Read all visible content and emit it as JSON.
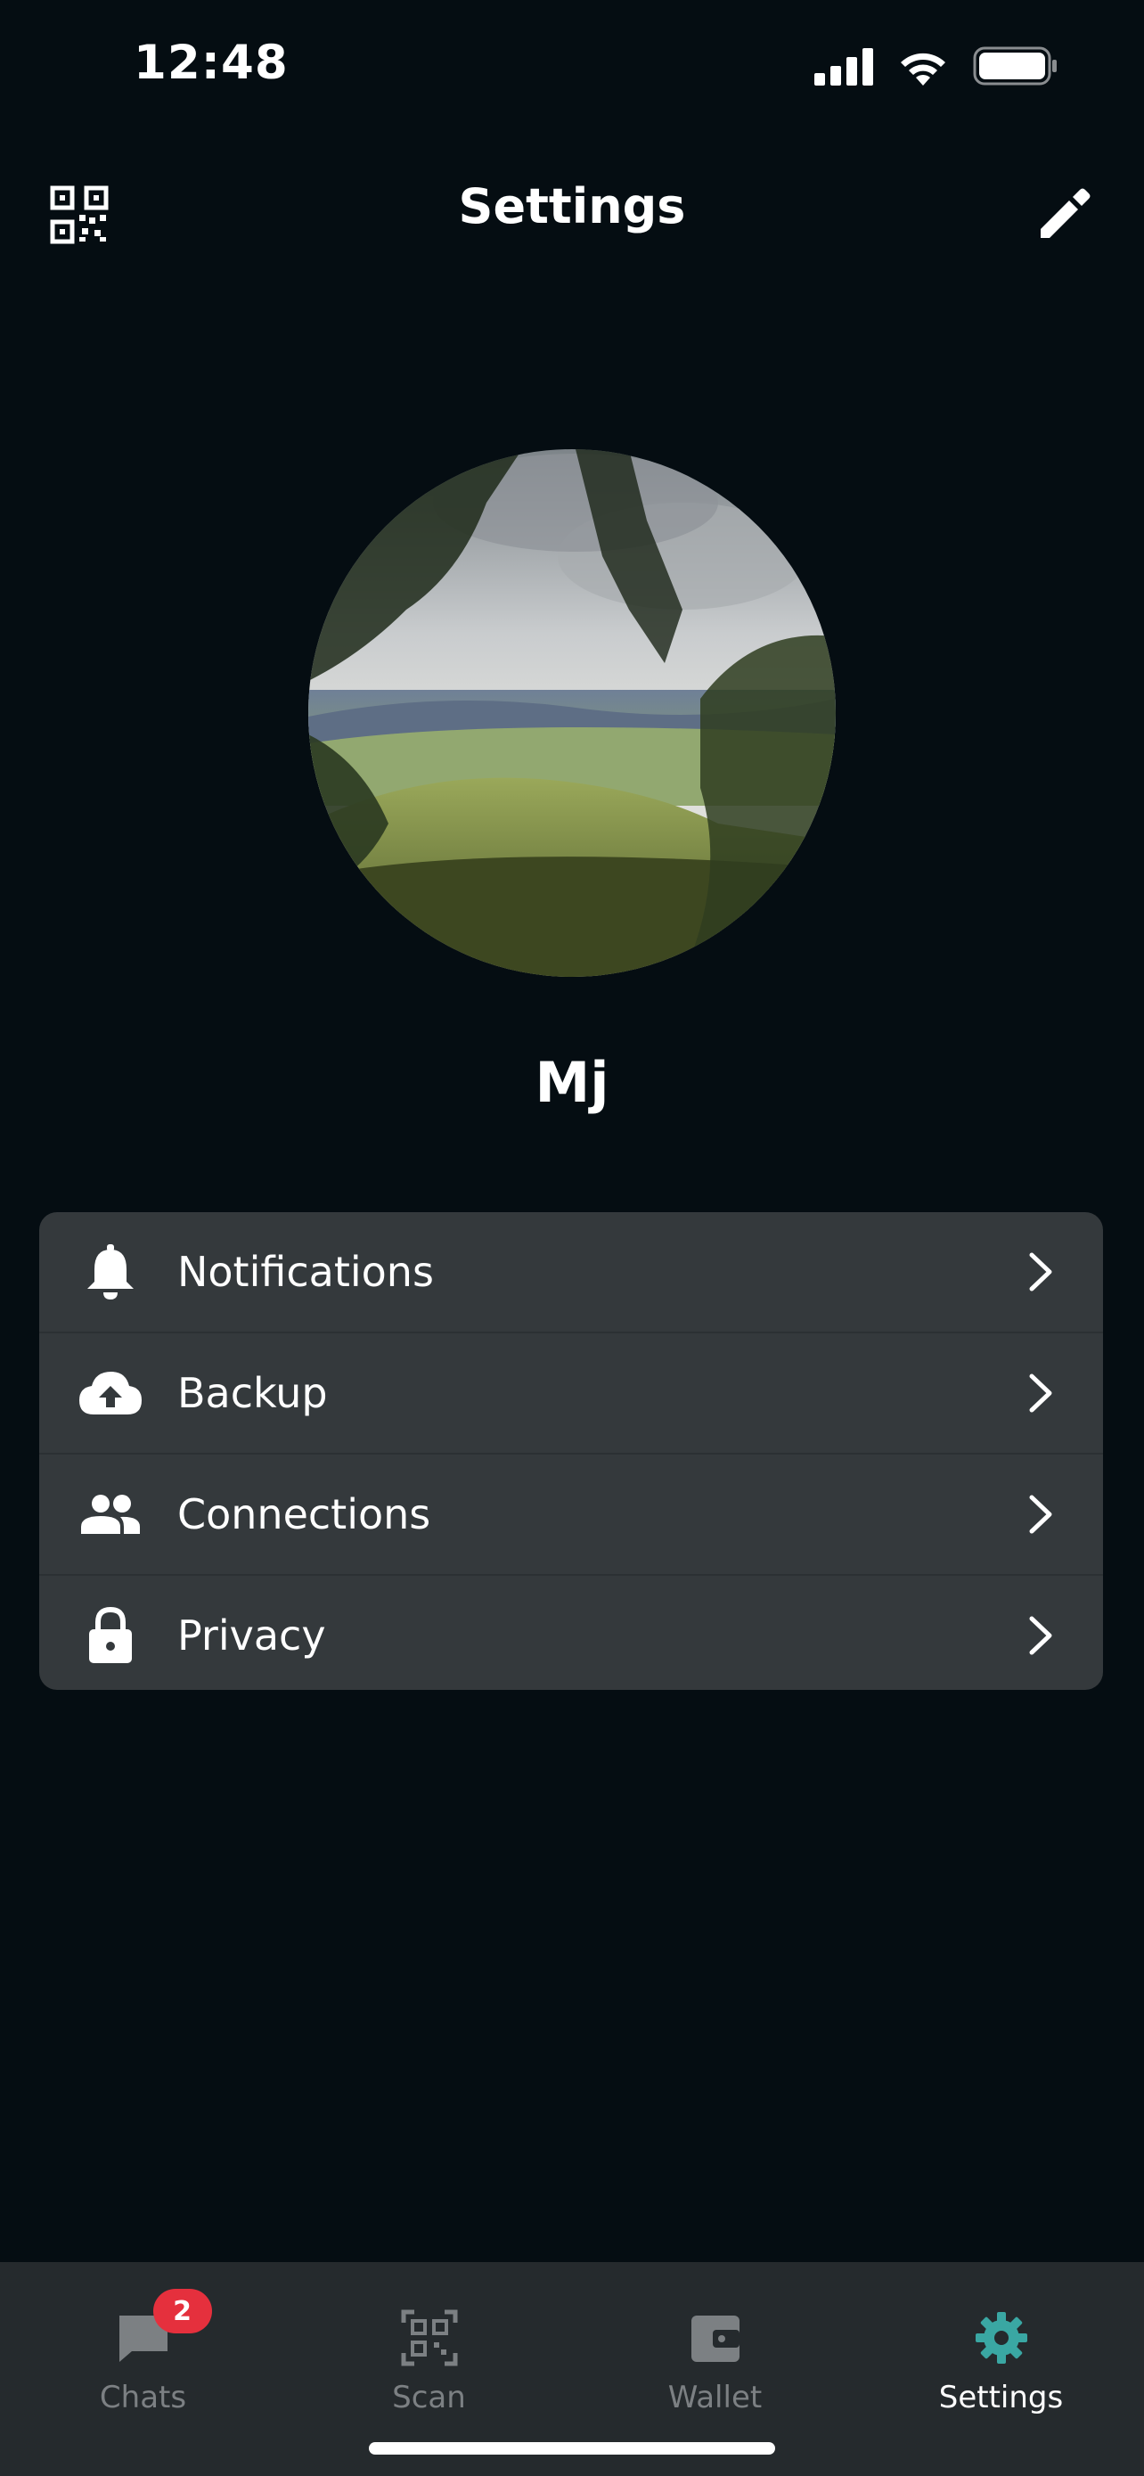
{
  "status_bar": {
    "time": "12:48",
    "signal_icon": "cellular-signal-icon",
    "wifi_icon": "wifi-icon",
    "battery_icon": "battery-icon"
  },
  "header": {
    "title": "Settings",
    "left_icon": "qr-code-icon",
    "right_icon": "pencil-edit-icon"
  },
  "profile": {
    "avatar": "profile-photo (landscape with trees)",
    "name": "Mj"
  },
  "settings": {
    "items": [
      {
        "label": "Notifications",
        "icon": "bell-icon"
      },
      {
        "label": "Backup",
        "icon": "cloud-upload-icon"
      },
      {
        "label": "Connections",
        "icon": "people-icon"
      },
      {
        "label": "Privacy",
        "icon": "lock-icon"
      }
    ]
  },
  "tabbar": {
    "tabs": [
      {
        "label": "Chats",
        "icon": "chat-bubble-icon",
        "badge": "2",
        "active": false
      },
      {
        "label": "Scan",
        "icon": "qr-scan-icon",
        "active": false
      },
      {
        "label": "Wallet",
        "icon": "wallet-icon",
        "active": false
      },
      {
        "label": "Settings",
        "icon": "gear-icon",
        "active": true
      }
    ]
  },
  "colors": {
    "background": "#050d12",
    "card": "#34393c",
    "tabbar": "#252a2d",
    "accent": "#3aa7a3",
    "badge": "#e5303d",
    "inactive_tab": "#7c8083"
  }
}
